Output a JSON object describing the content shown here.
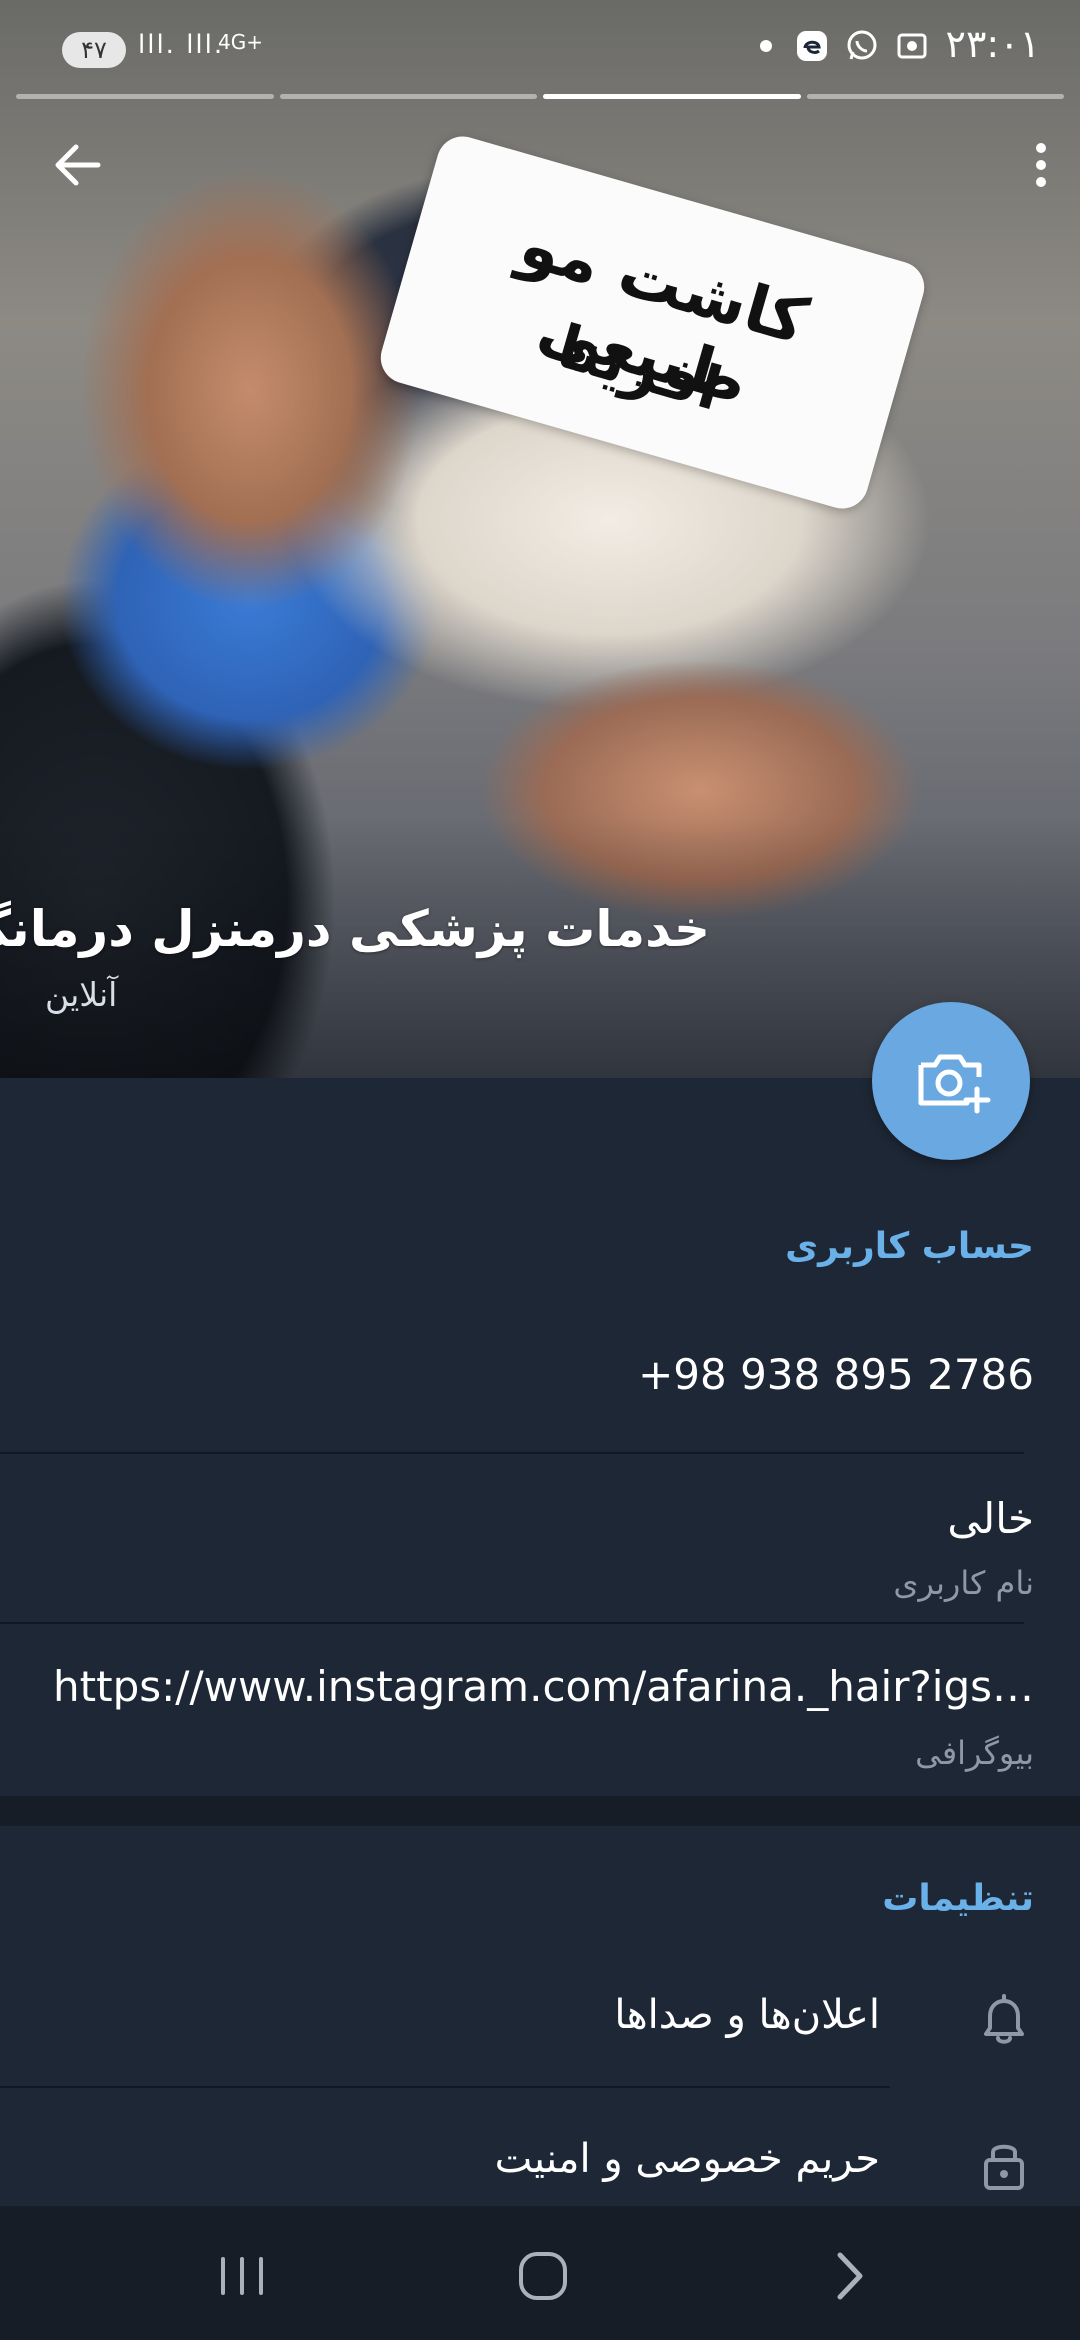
{
  "status_bar": {
    "time": "۲۳:۰۱",
    "battery": "۴۷",
    "signal": "lll. lll.",
    "network": "4G+",
    "icons": [
      "edge-browser-icon",
      "whatsapp-icon",
      "screen-record-icon"
    ]
  },
  "hero": {
    "sticker_line1": "کاشت مو طبیعی",
    "sticker_line2": "افرینا",
    "name": "خدمات پزشکی درمنزل درمانگر",
    "status": "آنلاین",
    "story_segments": 4,
    "active_segment": 3
  },
  "account": {
    "title": "حساب کاربری",
    "phone": "+98 938 895 2786",
    "username_value": "خالی",
    "username_caption": "نام کاربری",
    "bio_value": "https://www.instagram.com/afarina._hair?igs…",
    "bio_caption": "بیوگرافی"
  },
  "settings": {
    "title": "تنظیمات",
    "items": [
      {
        "label": "اعلان‌ها و صداها",
        "icon": "bell-icon"
      },
      {
        "label": "حریم خصوصی و امنیت",
        "icon": "lock-icon"
      }
    ]
  },
  "nav": {
    "icons": [
      "recent-apps-icon",
      "home-icon",
      "back-icon"
    ]
  },
  "colors": {
    "accent": "#6ab1ea",
    "fab": "#6aa8e2",
    "background": "#1e2735"
  }
}
